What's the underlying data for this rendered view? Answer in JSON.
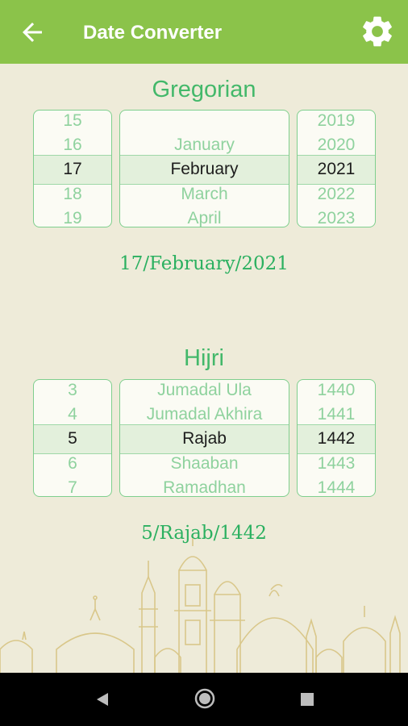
{
  "header": {
    "title": "Date Converter",
    "back_icon": "arrow-back-icon",
    "settings_icon": "gear-icon"
  },
  "gregorian": {
    "title": "Gregorian",
    "days": [
      "15",
      "16",
      "17",
      "18",
      "19"
    ],
    "months": [
      "",
      "January",
      "February",
      "March",
      "April"
    ],
    "years": [
      "2019",
      "2020",
      "2021",
      "2022",
      "2023"
    ],
    "result": "17/February/2021"
  },
  "hijri": {
    "title": "Hijri",
    "days": [
      "3",
      "4",
      "5",
      "6",
      "7"
    ],
    "months": [
      "Jumadal Ula",
      "Jumadal Akhira",
      "Rajab",
      "Shaaban",
      "Ramadhan"
    ],
    "years": [
      "1440",
      "1441",
      "1442",
      "1443",
      "1444"
    ],
    "result": "5/Rajab/1442"
  },
  "colors": {
    "appbar": "#8bc34a",
    "accent": "#43b86a",
    "background": "#eeebd9"
  },
  "navbar": {
    "back": "nav-back-icon",
    "home": "nav-home-icon",
    "recents": "nav-recents-icon"
  }
}
